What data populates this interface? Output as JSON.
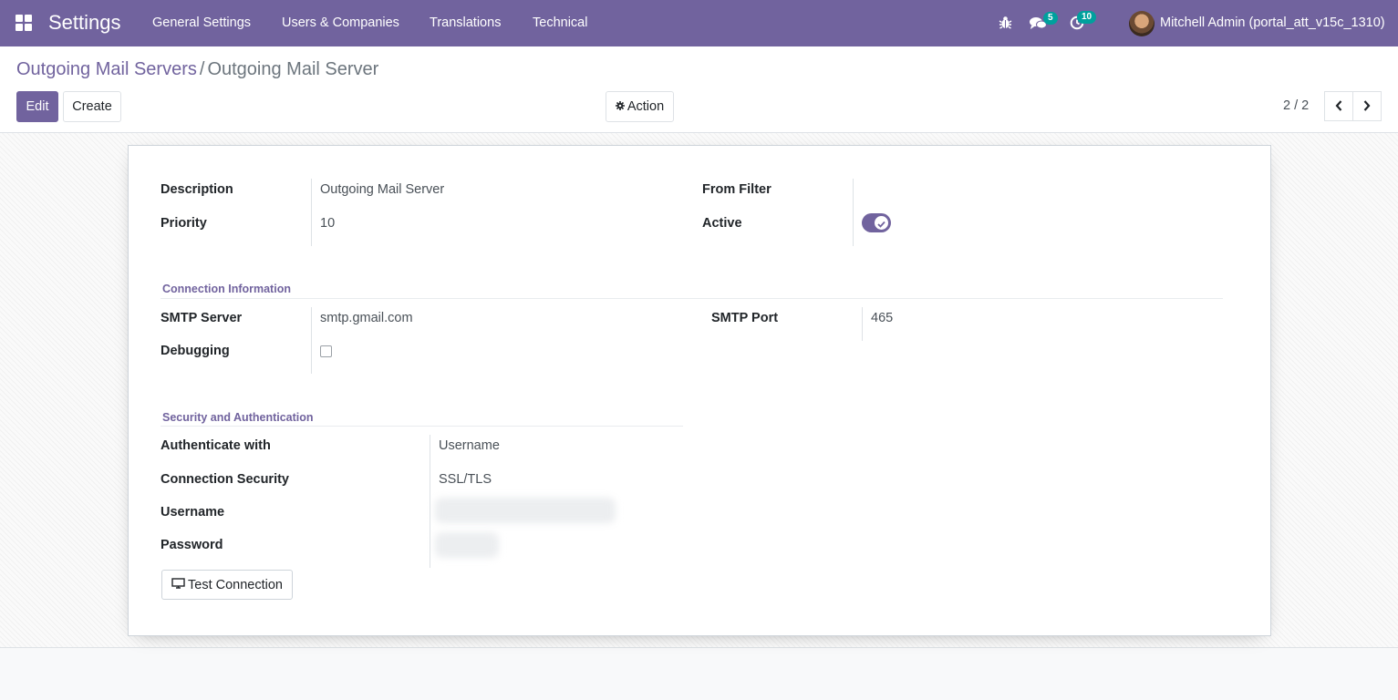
{
  "app": {
    "brand": "Settings",
    "menu": [
      {
        "label": "General Settings"
      },
      {
        "label": "Users & Companies"
      },
      {
        "label": "Translations"
      },
      {
        "label": "Technical"
      }
    ],
    "messages_count": "5",
    "activities_count": "10",
    "user_name": "Mitchell Admin (portal_att_v15c_1310)"
  },
  "breadcrumb": {
    "parent": "Outgoing Mail Servers",
    "separator": "/",
    "current": "Outgoing Mail Server"
  },
  "toolbar": {
    "edit": "Edit",
    "create": "Create",
    "action": "Action",
    "pager": "2 / 2"
  },
  "form": {
    "description_label": "Description",
    "description_value": "Outgoing Mail Server",
    "priority_label": "Priority",
    "priority_value": "10",
    "from_filter_label": "From Filter",
    "from_filter_value": "",
    "active_label": "Active",
    "active": true,
    "connection_section": "Connection Information",
    "smtp_server_label": "SMTP Server",
    "smtp_server_value": "smtp.gmail.com",
    "smtp_port_label": "SMTP Port",
    "smtp_port_value": "465",
    "debugging_label": "Debugging",
    "debugging": false,
    "security_section": "Security and Authentication",
    "auth_label": "Authenticate with",
    "auth_value": "Username",
    "conn_security_label": "Connection Security",
    "conn_security_value": "SSL/TLS",
    "username_label": "Username",
    "password_label": "Password",
    "test_button": "Test Connection"
  },
  "colors": {
    "brand": "#71639e",
    "badge": "#00a09d"
  }
}
